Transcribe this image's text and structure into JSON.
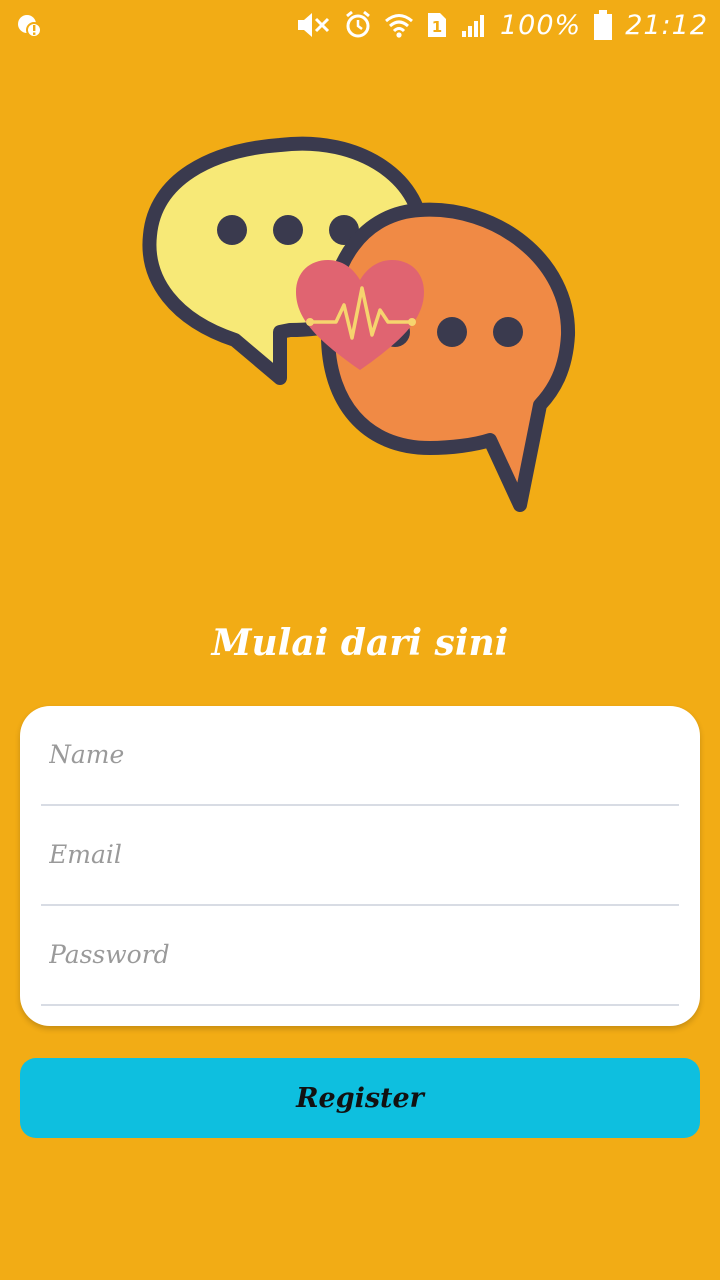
{
  "status_bar": {
    "battery_percent": "100%",
    "time": "21:12",
    "sim_slot": "1",
    "icons": [
      "notification-icon",
      "mute-icon",
      "alarm-icon",
      "wifi-icon",
      "sim-icon",
      "signal-icon",
      "battery-icon"
    ]
  },
  "illustration": {
    "icons": [
      "yellow-speech-bubble-icon",
      "orange-speech-bubble-icon",
      "heart-pulse-icon"
    ],
    "colors": {
      "yellow_bubble": "#F7E977",
      "orange_bubble": "#F08A45",
      "outline": "#3A3A4E",
      "heart": "#E06471",
      "pulse": "#F6D46E"
    }
  },
  "heading": "Mulai dari sini",
  "form": {
    "name_placeholder": "Name",
    "email_placeholder": "Email",
    "password_placeholder": "Password",
    "name_value": "",
    "email_value": "",
    "password_value": ""
  },
  "register_label": "Register",
  "colors": {
    "background": "#F2AC15",
    "button": "#0EBFDF",
    "card": "#FFFFFF"
  }
}
